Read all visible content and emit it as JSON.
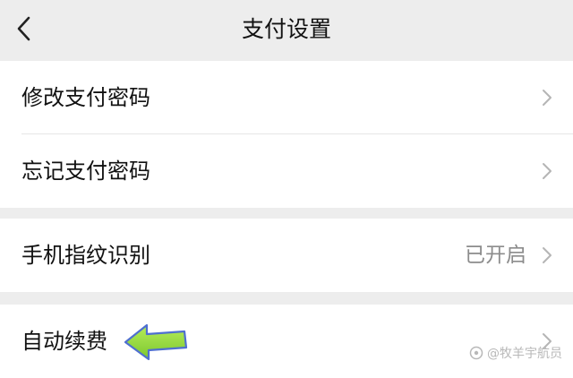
{
  "header": {
    "back_icon": "back-chevron-icon",
    "title": "支付设置"
  },
  "sections": [
    {
      "items": [
        {
          "label": "修改支付密码",
          "value": "",
          "icon": "chevron-right-icon"
        },
        {
          "label": "忘记支付密码",
          "value": "",
          "icon": "chevron-right-icon"
        }
      ]
    },
    {
      "items": [
        {
          "label": "手机指纹识别",
          "value": "已开启",
          "icon": "chevron-right-icon"
        }
      ]
    },
    {
      "items": [
        {
          "label": "自动续费",
          "value": "",
          "icon": "chevron-right-icon"
        }
      ]
    }
  ],
  "annotation": {
    "icon": "pointing-arrow-icon",
    "color": "#8fd33f"
  },
  "watermark": {
    "text": "@牧羊宇航员"
  },
  "colors": {
    "background": "#ededed",
    "card": "#ffffff",
    "text": "#111111",
    "secondary": "#8c8c8c",
    "chevron": "#b5b5b5"
  }
}
